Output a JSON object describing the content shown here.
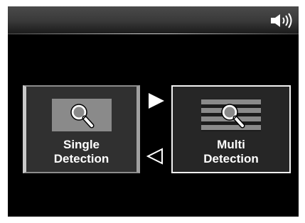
{
  "status": {
    "icon": "speaker-volume-icon"
  },
  "modes": {
    "single": {
      "line1": "Single",
      "line2": "Detection",
      "icon": "magnifier-icon"
    },
    "multi": {
      "line1": "Multi",
      "line2": "Detection",
      "icon": "magnifier-lines-icon"
    }
  },
  "navigation": {
    "next_icon": "triangle-right-filled-icon",
    "prev_icon": "triangle-left-outline-icon"
  },
  "colors": {
    "background": "#000000",
    "text": "#ffffff",
    "selected_border": "#f2f2f2",
    "unselected_border": "#8c8c8c"
  }
}
